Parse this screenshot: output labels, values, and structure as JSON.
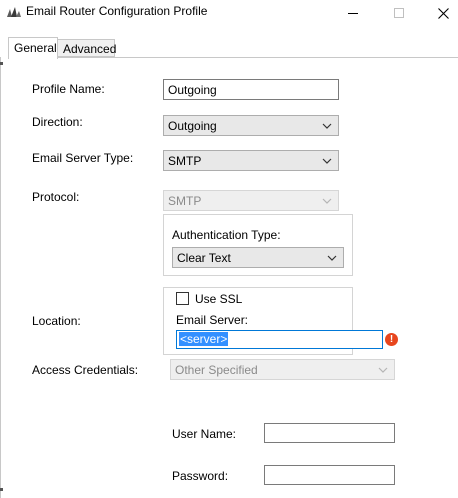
{
  "window": {
    "title": "Email Router Configuration Profile"
  },
  "tabs": [
    {
      "label": "General",
      "active": true
    },
    {
      "label": "Advanced",
      "active": false
    }
  ],
  "form": {
    "profile_name": {
      "label": "Profile Name:",
      "value": "Outgoing"
    },
    "direction": {
      "label": "Direction:",
      "value": "Outgoing"
    },
    "email_server_type": {
      "label": "Email Server Type:",
      "value": "SMTP"
    },
    "protocol": {
      "label": "Protocol:",
      "value": "SMTP",
      "disabled": true
    },
    "authentication_type": {
      "label": "Authentication Type:",
      "value": "Clear Text"
    },
    "location": {
      "label": "Location:",
      "use_ssl": {
        "label": "Use SSL",
        "checked": false
      },
      "email_server": {
        "label": "Email Server:",
        "value": "<server>"
      }
    },
    "access_credentials": {
      "label": "Access Credentials:",
      "value": "Other Specified",
      "disabled": true
    },
    "user_name": {
      "label": "User Name:",
      "value": ""
    },
    "password": {
      "label": "Password:",
      "value": ""
    }
  },
  "colors": {
    "focus_border": "#0078d7",
    "selection": "#3390ff",
    "error": "#e8461e"
  }
}
